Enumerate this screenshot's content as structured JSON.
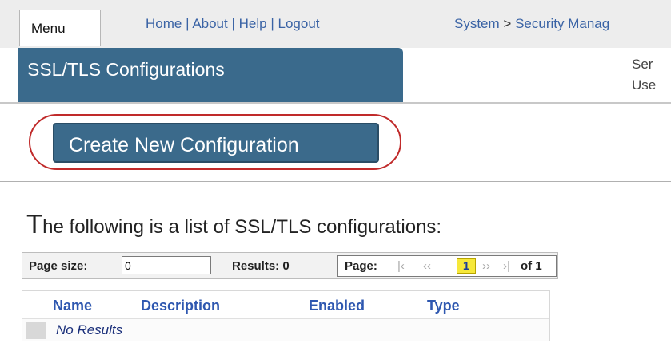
{
  "header": {
    "menu_label": "Menu",
    "links": [
      "Home",
      "About",
      "Help",
      "Logout"
    ],
    "link_separator": "|",
    "breadcrumb": {
      "root": "System",
      "separator": ">",
      "current": "Security Manag"
    }
  },
  "page": {
    "title": "SSL/TLS Configurations",
    "right_info_line1": "Ser",
    "right_info_line2": "Use",
    "create_button_label": "Create New Configuration",
    "intro_first_letter": "T",
    "intro_rest": "he following is a list of SSL/TLS configurations:"
  },
  "pager": {
    "page_size_label": "Page size:",
    "page_size_value": "0",
    "results_label": "Results: 0",
    "page_label": "Page:",
    "first_glyph": "|‹",
    "prev_glyph": "‹‹",
    "current_page": "1",
    "next_glyph": "››",
    "last_glyph": "›|",
    "of_label": "of 1"
  },
  "table": {
    "columns": [
      "Name",
      "Description",
      "Enabled",
      "Type"
    ],
    "empty_message": "No Results"
  },
  "colors": {
    "title_panel": "#3a6a8c",
    "button": "#3b6a8b",
    "highlight": "#c02a2a",
    "link": "#3a63a5",
    "current_page_bg": "#f6e83a"
  }
}
